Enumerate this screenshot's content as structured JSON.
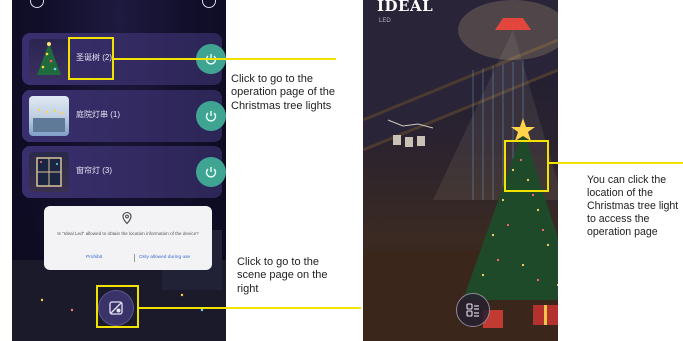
{
  "left_phone": {
    "devices": [
      {
        "label": "圣诞树 (2)",
        "thumb": "christmas-tree"
      },
      {
        "label": "庭院灯串 (1)",
        "thumb": "yard-string-lights"
      },
      {
        "label": "窗帘灯 (3)",
        "thumb": "curtain-lights"
      }
    ],
    "permission_dialog": {
      "icon": "location-pin-icon",
      "message": "Is \"Ideal Led\" allowed to obtain the location information of the device?",
      "prohibit_label": "Prohibit",
      "allow_label": "Only allowed during use"
    },
    "scene_button_icon": "scene-icon"
  },
  "right_phone": {
    "brand": "IDEAL",
    "brand_sub": "LED",
    "menu_button_icon": "menu-grid-icon"
  },
  "annotations": {
    "card_note": "Click to go to the operation page of the Christmas tree lights",
    "scene_note": "Click to go to the scene page on the right",
    "tree_note": "You can click the location of the Christmas tree light to access the operation page"
  },
  "colors": {
    "highlight": "#f2e200",
    "card": "#3a2f6e",
    "power": "#3fa491",
    "dialog_link": "#3a6ad1"
  }
}
